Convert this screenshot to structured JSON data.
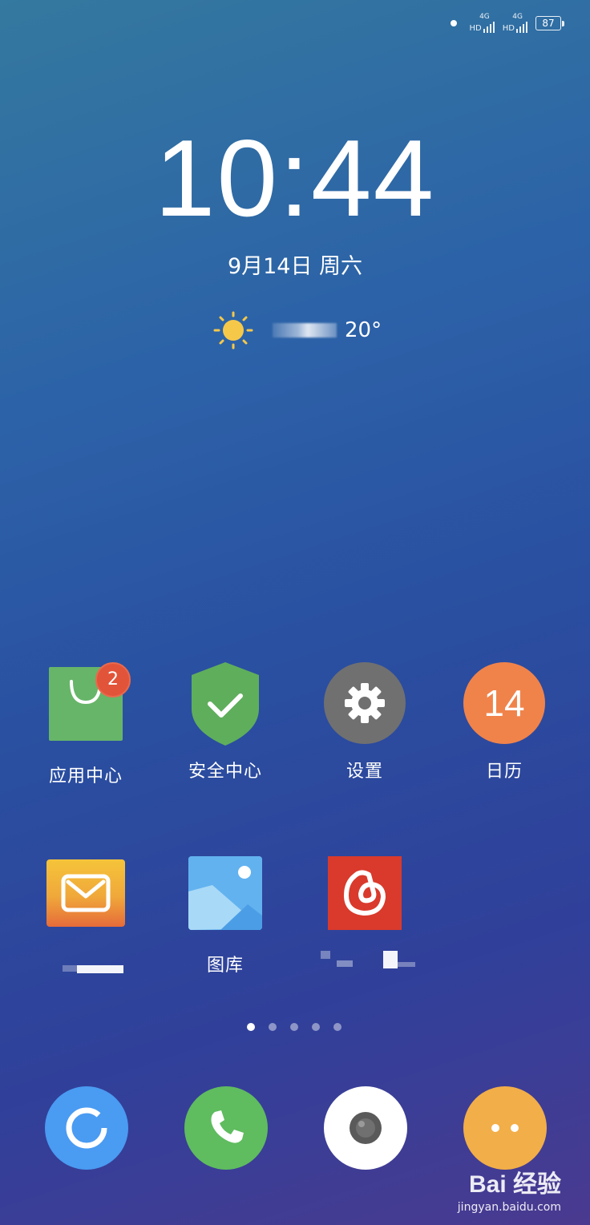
{
  "status_bar": {
    "network1": "HD",
    "network1_type": "4G",
    "network2": "HD",
    "network2_type": "4G",
    "battery": "87"
  },
  "lockscreen": {
    "time": "10:44",
    "date": "9月14日  周六",
    "temperature": "20°"
  },
  "apps_row1": [
    {
      "label": "应用中心",
      "badge": "2"
    },
    {
      "label": "安全中心"
    },
    {
      "label": "设置"
    },
    {
      "label": "日历",
      "icon_text": "14"
    }
  ],
  "apps_row2": [
    {
      "label": ""
    },
    {
      "label": "图库"
    },
    {
      "label": ""
    }
  ],
  "page_indicator": {
    "count": 5,
    "active": 1
  },
  "watermark": {
    "brand": "Bai 经验",
    "url": "jingyan.baidu.com"
  },
  "colors": {
    "appstore": "#67b569",
    "badge": "#e2543a",
    "security": "#5fae5c",
    "settings": "#707070",
    "calendar": "#f0834a",
    "browser": "#4a9bf2",
    "phone": "#5fbc5f",
    "camera": "#ffffff",
    "messages": "#f2ae48"
  }
}
